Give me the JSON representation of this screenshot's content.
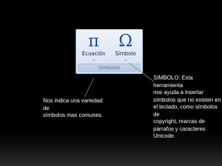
{
  "ribbon": {
    "buttons": [
      {
        "icon": "pi-icon",
        "glyph": "π",
        "label": "Ecuación",
        "dropdown": "⌄"
      },
      {
        "icon": "omega-icon",
        "glyph": "Ω",
        "label": "Símbolo",
        "dropdown": "⌄"
      }
    ],
    "group_label": "Símbolos"
  },
  "annotations": {
    "simbolo": "SIMBOLO: Esta herramienta\nnos ayuda a insertar\nsímbolos que no existen en\nel teclado, como símbolos de\ncopyright, marcas de\npárrafos y caracteres\nUnicode.",
    "ecuacion": "Nos indica una variedad de\nsímbolos mas comunes."
  },
  "colors": {
    "background": "#000000",
    "ribbon_bg": "#dfe8f5",
    "icon_blue": "#1f4f8f",
    "text": "#ffffff",
    "connector": "#7f9e3a"
  }
}
